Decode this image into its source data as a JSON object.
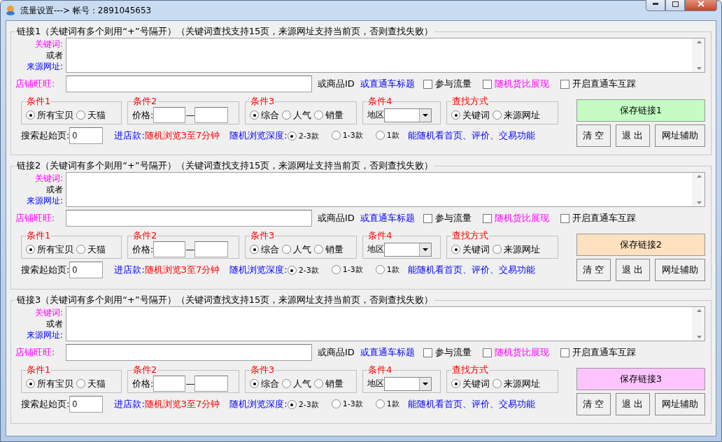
{
  "window": {
    "title": "流量设置---> 帐号：2891045653"
  },
  "sections": [
    {
      "title": "链接1（关键词有多个则用“+”号隔开）（关键词查找支持15页，来源网址支持当前页，否则查找失败）",
      "keyword_labels": [
        {
          "label": "关键词:",
          "kind": "keyword"
        },
        {
          "label": "或者",
          "kind": "plain"
        },
        {
          "label": "来源网址:",
          "kind": "source"
        }
      ],
      "shop_label": "店铺旺旺:",
      "or_id": "或商品ID",
      "ztc_title": "或直通车标题",
      "checkboxes": [
        {
          "label": "参与流量",
          "checked": false,
          "kind": "plain"
        },
        {
          "label": "随机货比展现",
          "checked": false,
          "kind": "highlight"
        },
        {
          "label": "开启直通车互踩",
          "checked": false,
          "kind": "plain"
        }
      ],
      "groups": [
        {
          "kind": "radio",
          "title": "条件1",
          "options": [
            {
              "label": "所有宝贝",
              "selected": true
            },
            {
              "label": "天猫",
              "selected": false
            }
          ]
        },
        {
          "kind": "range",
          "title": "条件2",
          "label": "价格:",
          "separator": "—"
        },
        {
          "kind": "radio",
          "title": "条件3",
          "options": [
            {
              "label": "综合",
              "selected": true
            },
            {
              "label": "人气",
              "selected": false
            },
            {
              "label": "销量",
              "selected": false
            }
          ]
        },
        {
          "kind": "select",
          "title": "条件4",
          "label": "地区"
        },
        {
          "kind": "radio",
          "title": "查找方式",
          "options": [
            {
              "label": "关键词",
              "selected": true
            },
            {
              "label": "来源网址",
              "selected": false
            }
          ]
        }
      ],
      "start_page": {
        "label": "搜索起始页:",
        "value": "0"
      },
      "enter_shop": {
        "label": "进店款:",
        "value": "随机浏览3至7分钟"
      },
      "depth": {
        "label": "随机浏览深度:",
        "options": [
          {
            "label": "2-3款",
            "selected": true
          },
          {
            "label": "1-3款",
            "selected": false
          },
          {
            "label": "1款",
            "selected": false
          }
        ]
      },
      "note": "能随机看首页、评价、交易功能",
      "save_button": {
        "label": "保存链接1",
        "color": "#c4fcc4"
      },
      "buttons": [
        "清 空",
        "退 出",
        "网址辅助"
      ]
    },
    {
      "title": "链接2（关键词有多个则用“+”号隔开）（关键词查找支持15页，来源网址支持当前页，否则查找失败）",
      "keyword_labels": [
        {
          "label": "关键词:",
          "kind": "keyword"
        },
        {
          "label": "或者",
          "kind": "plain"
        },
        {
          "label": "来源网址:",
          "kind": "source"
        }
      ],
      "shop_label": "店铺旺旺:",
      "or_id": "或商品ID",
      "ztc_title": "或直通车标题",
      "checkboxes": [
        {
          "label": "参与流量",
          "checked": false,
          "kind": "plain"
        },
        {
          "label": "随机货比展现",
          "checked": false,
          "kind": "highlight"
        },
        {
          "label": "开启直通车互踩",
          "checked": false,
          "kind": "plain"
        }
      ],
      "groups": [
        {
          "kind": "radio",
          "title": "条件1",
          "options": [
            {
              "label": "所有宝贝",
              "selected": true
            },
            {
              "label": "天猫",
              "selected": false
            }
          ]
        },
        {
          "kind": "range",
          "title": "条件2",
          "label": "价格:",
          "separator": "—"
        },
        {
          "kind": "radio",
          "title": "条件3",
          "options": [
            {
              "label": "综合",
              "selected": true
            },
            {
              "label": "人气",
              "selected": false
            },
            {
              "label": "销量",
              "selected": false
            }
          ]
        },
        {
          "kind": "select",
          "title": "条件4",
          "label": "地区"
        },
        {
          "kind": "radio",
          "title": "查找方式",
          "options": [
            {
              "label": "关键词",
              "selected": true
            },
            {
              "label": "来源网址",
              "selected": false
            }
          ]
        }
      ],
      "start_page": {
        "label": "搜索起始页:",
        "value": "0"
      },
      "enter_shop": {
        "label": "进店款:",
        "value": "随机浏览3至7分钟"
      },
      "depth": {
        "label": "随机浏览深度:",
        "options": [
          {
            "label": "2-3款",
            "selected": true
          },
          {
            "label": "1-3款",
            "selected": false
          },
          {
            "label": "1款",
            "selected": false
          }
        ]
      },
      "note": "能随机看首页、评价、交易功能",
      "save_button": {
        "label": "保存链接2",
        "color": "#ffe0c0"
      },
      "buttons": [
        "清 空",
        "退 出",
        "网址辅助"
      ]
    },
    {
      "title": "链接3（关键词有多个则用“+”号隔开）（关键词查找支持15页，来源网址支持当前页，否则查找失败）",
      "keyword_labels": [
        {
          "label": "关键词:",
          "kind": "keyword"
        },
        {
          "label": "或者",
          "kind": "plain"
        },
        {
          "label": "来源网址:",
          "kind": "source"
        }
      ],
      "shop_label": "店铺旺旺:",
      "or_id": "或商品ID",
      "ztc_title": "或直通车标题",
      "checkboxes": [
        {
          "label": "参与流量",
          "checked": false,
          "kind": "plain"
        },
        {
          "label": "随机货比展现",
          "checked": false,
          "kind": "highlight"
        },
        {
          "label": "开启直通车互踩",
          "checked": false,
          "kind": "plain"
        }
      ],
      "groups": [
        {
          "kind": "radio",
          "title": "条件1",
          "options": [
            {
              "label": "所有宝贝",
              "selected": true
            },
            {
              "label": "天猫",
              "selected": false
            }
          ]
        },
        {
          "kind": "range",
          "title": "条件2",
          "label": "价格:",
          "separator": "—"
        },
        {
          "kind": "radio",
          "title": "条件3",
          "options": [
            {
              "label": "综合",
              "selected": true
            },
            {
              "label": "人气",
              "selected": false
            },
            {
              "label": "销量",
              "selected": false
            }
          ]
        },
        {
          "kind": "select",
          "title": "条件4",
          "label": "地区"
        },
        {
          "kind": "radio",
          "title": "查找方式",
          "options": [
            {
              "label": "关键词",
              "selected": true
            },
            {
              "label": "来源网址",
              "selected": false
            }
          ]
        }
      ],
      "start_page": {
        "label": "搜索起始页:",
        "value": "0"
      },
      "enter_shop": {
        "label": "进店款:",
        "value": "随机浏览3至7分钟"
      },
      "depth": {
        "label": "随机浏览深度:",
        "options": [
          {
            "label": "2-3款",
            "selected": true
          },
          {
            "label": "1-3款",
            "selected": false
          },
          {
            "label": "1款",
            "selected": false
          }
        ]
      },
      "note": "能随机看首页、评价、交易功能",
      "save_button": {
        "label": "保存链接3",
        "color": "#ffc4ff"
      },
      "buttons": [
        "清 空",
        "退 出",
        "网址辅助"
      ]
    }
  ]
}
